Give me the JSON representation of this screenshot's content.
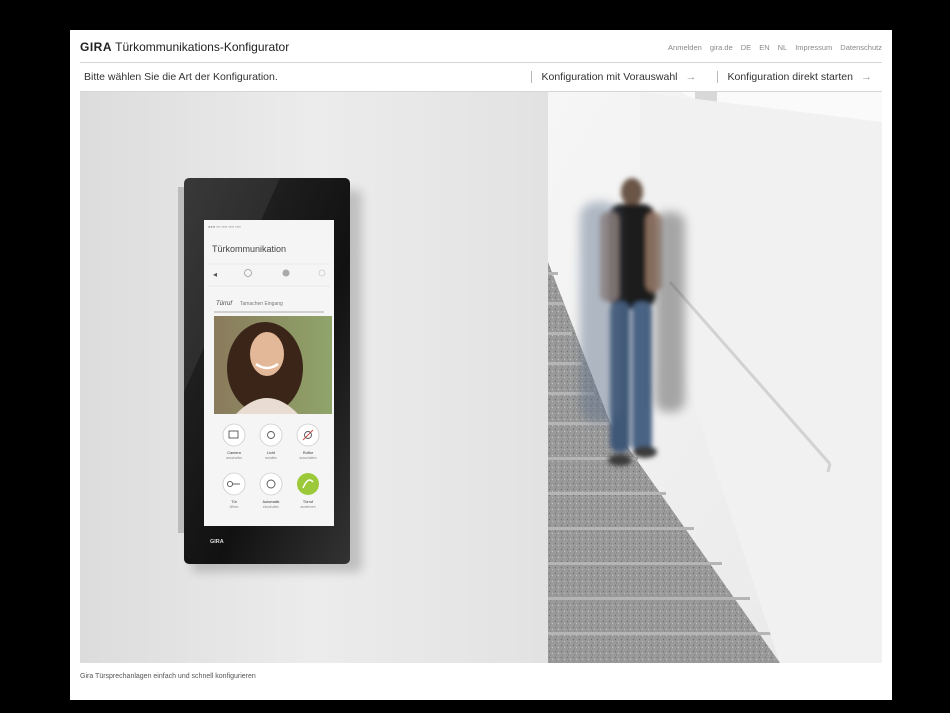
{
  "header": {
    "brand_name": "GIRA",
    "app_title": "Türkommunikations-Konfigurator",
    "nav": [
      "Anmelden",
      "gira.de",
      "DE",
      "EN",
      "NL",
      "Impressum",
      "Datenschutz"
    ]
  },
  "config_bar": {
    "prompt": "Bitte wählen Sie die Art der Konfiguration.",
    "option_preselection": "Konfiguration mit Vorauswahl",
    "option_direct": "Konfiguration direkt starten",
    "arrow": "→"
  },
  "device_screen": {
    "title": "Türkommunikation",
    "door_label": "Türruf",
    "door_sub": "Tamachen Eingang",
    "buttons": [
      {
        "label": "Camera",
        "sub": "umschalten"
      },
      {
        "label": "Licht",
        "sub": "schalten"
      },
      {
        "label": "Ruftor",
        "sub": "ausschalten"
      },
      {
        "label": "Tür",
        "sub": "öffnen"
      },
      {
        "label": "Automatik",
        "sub": "einschalten"
      },
      {
        "label": "Türruf",
        "sub": "annehmen"
      }
    ],
    "device_logo": "GIRA"
  },
  "footer": {
    "caption": "Gira Türsprechanlagen einfach und schnell konfigurieren"
  },
  "colors": {
    "accent_green": "#9cc93a",
    "page_bg": "#000000",
    "content_bg": "#ffffff"
  }
}
